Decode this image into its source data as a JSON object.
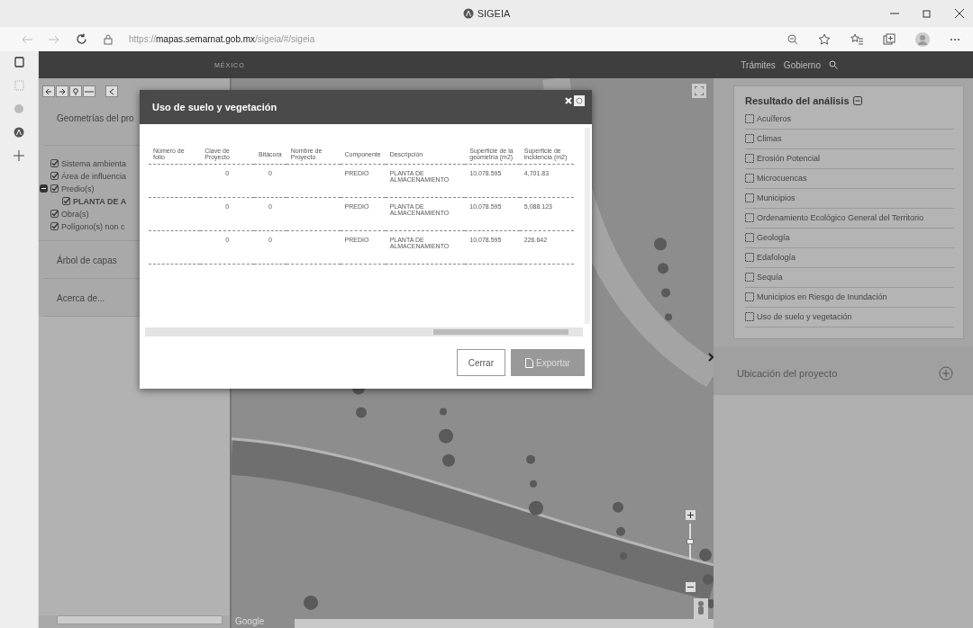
{
  "browser": {
    "tab_title": "SIGEIA",
    "url_prefix": "https://",
    "url_host": "mapas.semarnat.gob.mx",
    "url_path": "/sigeia/#/sigeia"
  },
  "header": {
    "logo": "MÉXICO",
    "links": [
      "Trámites",
      "Gobierno"
    ]
  },
  "left_panel": {
    "section": "Geometrías del pro",
    "layers": [
      {
        "label": "Sistema ambienta",
        "checked": true
      },
      {
        "label": "Área de influencia",
        "checked": true
      },
      {
        "label": "Predio(s)",
        "checked": true,
        "expanded": true,
        "children": [
          {
            "label": "PLANTA DE A",
            "checked": true
          }
        ]
      },
      {
        "label": "Obra(s)",
        "checked": true
      },
      {
        "label": "Polígono(s) non c",
        "checked": true
      }
    ],
    "links": [
      "Árbol de capas",
      "Acerca de..."
    ]
  },
  "map": {
    "brand": "Google",
    "zoom": {
      "level": 0.5
    }
  },
  "dialog": {
    "title": "Uso de suelo y vegetación",
    "columns": [
      "Número de folio",
      "Clave de Proyecto",
      "Bitácora",
      "Nombre de Proyecto",
      "Componente",
      "Descripción",
      "Superficie de la geometría (m2)",
      "Superficie de incidencia (m2)"
    ],
    "rows": [
      {
        "clave": "0",
        "bitacora": "0",
        "componente": "PREDIO",
        "descripcion": "PLANTA DE ALMACENAMIENTO",
        "sup_geometria": "10,078.595",
        "sup_incidencia": "4,701.83"
      },
      {
        "clave": "0",
        "bitacora": "0",
        "componente": "PREDIO",
        "descripcion": "PLANTA DE ALMACENAMIENTO",
        "sup_geometria": "10,078.595",
        "sup_incidencia": "5,088.123"
      },
      {
        "clave": "0",
        "bitacora": "0",
        "componente": "PREDIO",
        "descripcion": "PLANTA DE ALMACENAMIENTO",
        "sup_geometria": "10,078.595",
        "sup_incidencia": "226.642"
      }
    ],
    "buttons": [
      {
        "label": "Cerrar",
        "kind": "secondary",
        "disabled": false
      },
      {
        "label": "Exportar",
        "kind": "export",
        "disabled": true
      }
    ]
  },
  "right_panel": {
    "title": "Resultado del análisis",
    "expanded": true,
    "items": [
      {
        "label": "Acuíferos",
        "checked": false
      },
      {
        "label": "Climas",
        "checked": false
      },
      {
        "label": "Erosión Potencial",
        "checked": false
      },
      {
        "label": "Microcuencas",
        "checked": false
      },
      {
        "label": "Municipios",
        "checked": false
      },
      {
        "label": "Ordenamiento Ecológico General del Territorio",
        "checked": false
      },
      {
        "label": "Geología",
        "checked": false
      },
      {
        "label": "Edafología",
        "checked": false
      },
      {
        "label": "Sequía",
        "checked": false
      },
      {
        "label": "Municipios en Riesgo de Inundación",
        "checked": false
      },
      {
        "label": "Uso de suelo y vegetación",
        "checked": false
      }
    ],
    "footer": "Ubicación del proyecto"
  }
}
